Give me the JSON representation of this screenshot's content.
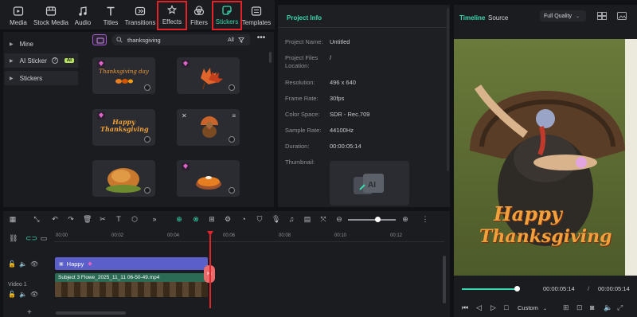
{
  "toolbar": {
    "items": [
      {
        "label": "Media",
        "icon": "media-icon"
      },
      {
        "label": "Stock Media",
        "icon": "stock-media-icon"
      },
      {
        "label": "Audio",
        "icon": "audio-icon"
      },
      {
        "label": "Titles",
        "icon": "titles-icon"
      },
      {
        "label": "Transitions",
        "icon": "transitions-icon"
      },
      {
        "label": "Effects",
        "icon": "effects-icon"
      },
      {
        "label": "Filters",
        "icon": "filters-icon"
      },
      {
        "label": "Stickers",
        "icon": "stickers-icon"
      },
      {
        "label": "Templates",
        "icon": "templates-icon"
      }
    ],
    "highlight_color": "#e0242a",
    "active_color": "#38d9b0"
  },
  "leftnav": {
    "items": [
      {
        "label": "Mine"
      },
      {
        "label": "AI Sticker",
        "badge": "AI"
      },
      {
        "label": "Stickers"
      }
    ]
  },
  "stickers": {
    "search_value": "thanksgiving",
    "filter_label": "All",
    "cards": [
      {
        "text": "Thanksgiving day"
      },
      {
        "text": ""
      },
      {
        "text": "Happy Thanksgiving"
      },
      {
        "text": ""
      },
      {
        "text": ""
      },
      {
        "text": ""
      }
    ]
  },
  "project_info": {
    "title": "Project Info",
    "rows": [
      {
        "label": "Project Name:",
        "value": "Untitled"
      },
      {
        "label": "Project Files Location:",
        "value": "/"
      },
      {
        "label": "Resolution:",
        "value": "496 x 640"
      },
      {
        "label": "Frame Rate:",
        "value": "30fps"
      },
      {
        "label": "Color Space:",
        "value": "SDR - Rec.709"
      },
      {
        "label": "Sample Rate:",
        "value": "44100Hz"
      },
      {
        "label": "Duration:",
        "value": "00:00:05:14"
      },
      {
        "label": "Thumbnail:",
        "value": ""
      }
    ]
  },
  "preview": {
    "tab_timeline": "Timeline",
    "tab_source": "Source",
    "quality": "Full Quality",
    "overlay_line1": "Happy",
    "overlay_line2": "Thanksgiving",
    "current_time": "00:00:05:14",
    "separator": "/",
    "total_time": "00:00:05:14",
    "zoom_mode": "Custom",
    "progress": 1.0
  },
  "timeline": {
    "ruler": [
      "00:00",
      "00:02",
      "00:04",
      "00:06",
      "00:08",
      "00:10",
      "00:12"
    ],
    "sticker_clip": "Happy",
    "video_clip": "Subject 3 Flowe_2025_11_11 06-50-49.mp4",
    "track_label": "Video 1"
  }
}
